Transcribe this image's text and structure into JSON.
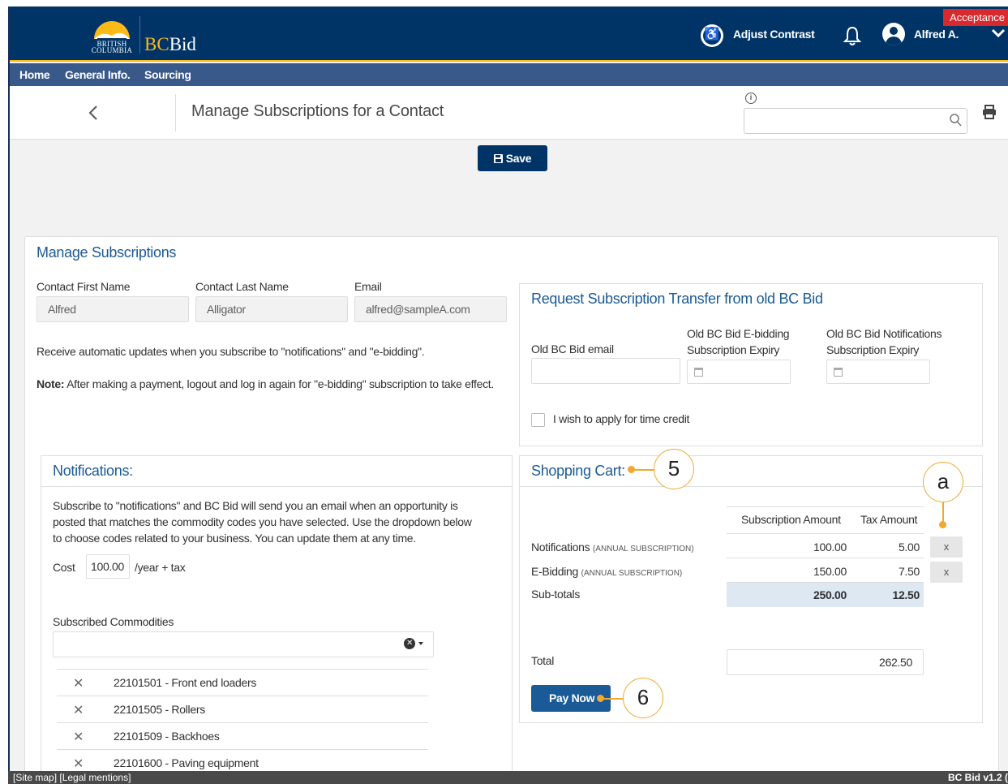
{
  "header": {
    "logo_text": "BRITISH COLUMBIA",
    "brand_prefix": "BC",
    "brand_suffix": "Bid",
    "environment_badge": "Acceptance",
    "adjust_contrast": "Adjust Contrast",
    "user_name": "Alfred A."
  },
  "nav": {
    "items": [
      "Home",
      "General Info.",
      "Sourcing"
    ]
  },
  "titlebar": {
    "title": "Manage Subscriptions for a Contact",
    "info": "i"
  },
  "toolbar": {
    "save_label": "Save"
  },
  "manage": {
    "title": "Manage Subscriptions",
    "first_name_label": "Contact First Name",
    "first_name_value": "Alfred",
    "last_name_label": "Contact Last Name",
    "last_name_value": "Alligator",
    "email_label": "Email",
    "email_value": "alfred@sampleA.com",
    "info_text": "Receive automatic updates when you subscribe to \"notifications\" and \"e-bidding\".",
    "note_bold": "Note:",
    "note_text": " After making a payment, logout and log in again for \"e-bidding\" subscription to take effect."
  },
  "transfer": {
    "title": "Request Subscription Transfer from old BC Bid",
    "old_email_label": "Old BC Bid email",
    "ebid_expiry_label_1": "Old BC Bid E-bidding",
    "ebid_expiry_label_2": "Subscription Expiry",
    "notif_expiry_label_1": "Old BC Bid Notifications",
    "notif_expiry_label_2": "Subscription Expiry",
    "time_credit_label": "I wish to apply for time credit"
  },
  "notifications": {
    "title": "Notifications:",
    "desc_1": "Subscribe to \"notifications\" and BC Bid will send you an email when an opportunity is",
    "desc_2": "posted that matches the commodity codes you have selected. Use the dropdown below",
    "desc_3": "to choose codes related to your business. You can update them at any time.",
    "cost_label": "Cost",
    "cost_value": "100.00",
    "cost_suffix": "/year + tax",
    "commodities_label": "Subscribed Commodities",
    "commodities": [
      "22101501 - Front end loaders",
      "22101505 - Rollers",
      "22101509 - Backhoes",
      "22101600 - Paving equipment"
    ]
  },
  "cart": {
    "title": "Shopping Cart:",
    "col_subscription": "Subscription Amount",
    "col_tax": "Tax Amount",
    "rows": [
      {
        "name": "Notifications",
        "qualifier": "(ANNUAL SUBSCRIPTION)",
        "amount": "100.00",
        "tax": "5.00",
        "remove": "x"
      },
      {
        "name": "E-Bidding",
        "qualifier": "(ANNUAL SUBSCRIPTION)",
        "amount": "150.00",
        "tax": "7.50",
        "remove": "x"
      }
    ],
    "subtotal_label": "Sub-totals",
    "subtotal_amount": "250.00",
    "subtotal_tax": "12.50",
    "total_label": "Total",
    "total_value": "262.50",
    "pay_label": "Pay Now"
  },
  "callouts": {
    "shopping_cart": "5",
    "pay_now": "6",
    "remove": "a"
  },
  "footer": {
    "links": "[Site map] [Legal mentions]",
    "version": "BC Bid v1.2 ("
  },
  "colors": {
    "primary": "#003366",
    "nav": "#38598a",
    "accent": "#fcba19",
    "link": "#1a5a96",
    "callout": "#f0a830",
    "badge": "#d8292f"
  }
}
